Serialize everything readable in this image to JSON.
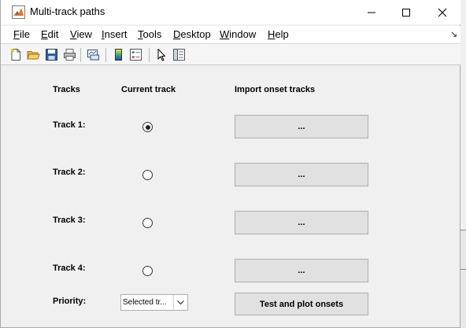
{
  "window": {
    "title": "Multi-track paths"
  },
  "menu": [
    "File",
    "Edit",
    "View",
    "Insert",
    "Tools",
    "Desktop",
    "Window",
    "Help"
  ],
  "toolbar": [
    "new-figure-icon",
    "open-file-icon",
    "save-icon",
    "print-icon",
    "link-plot-icon",
    "colorbar-icon",
    "legend-icon",
    "pointer-icon",
    "property-editor-icon"
  ],
  "headers": {
    "tracks": "Tracks",
    "current": "Current track",
    "import": "Import onset tracks"
  },
  "tracks": [
    {
      "label": "Track 1:",
      "selected": true,
      "import_label": "..."
    },
    {
      "label": "Track 2:",
      "selected": false,
      "import_label": "..."
    },
    {
      "label": "Track 3:",
      "selected": false,
      "import_label": "..."
    },
    {
      "label": "Track 4:",
      "selected": false,
      "import_label": "..."
    }
  ],
  "priority": {
    "label": "Priority:",
    "value": "Selected tr..."
  },
  "actions": {
    "test_plot": "Test and plot onsets"
  }
}
